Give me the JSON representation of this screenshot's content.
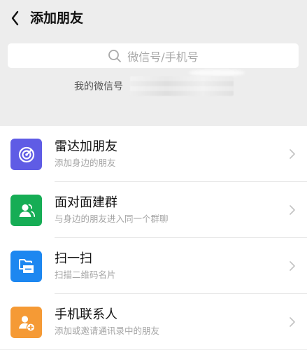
{
  "header": {
    "title": "添加朋友",
    "back_icon": "chevron-left-icon"
  },
  "search": {
    "placeholder": "微信号/手机号",
    "icon": "search-icon"
  },
  "my_id": {
    "label": "我的微信号"
  },
  "items": [
    {
      "title": "雷达加朋友",
      "subtitle": "添加身边的朋友",
      "icon": "radar-icon",
      "color": "#5f5ce5"
    },
    {
      "title": "面对面建群",
      "subtitle": "与身边的朋友进入同一个群聊",
      "icon": "face-to-face-group-icon",
      "color": "#16ad55"
    },
    {
      "title": "扫一扫",
      "subtitle": "扫描二维码名片",
      "icon": "scan-icon",
      "color": "#1d87f0"
    },
    {
      "title": "手机联系人",
      "subtitle": "添加或邀请通讯录中的朋友",
      "icon": "contacts-add-icon",
      "color": "#f59a35"
    }
  ]
}
